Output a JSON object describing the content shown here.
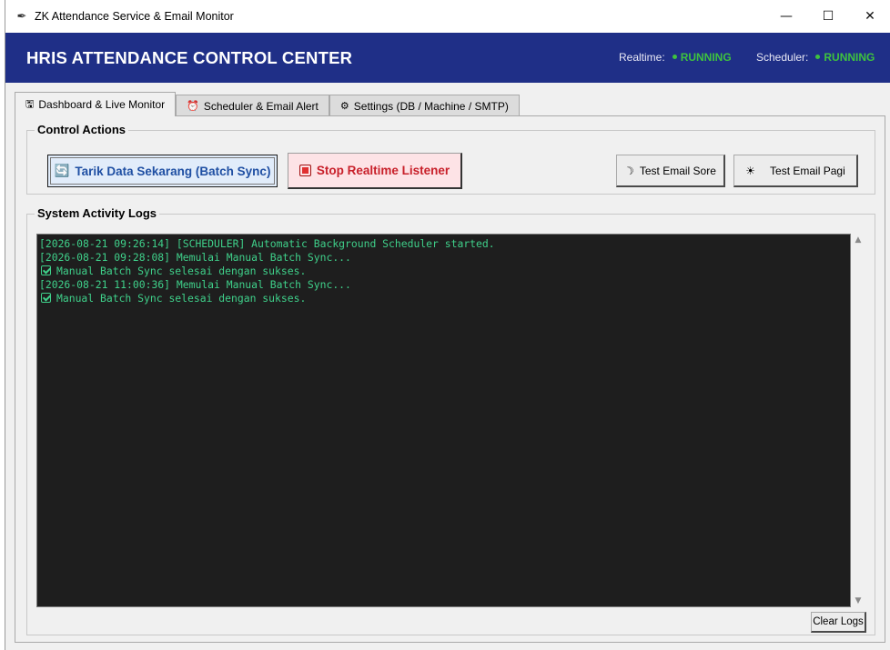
{
  "window": {
    "title": "ZK Attendance Service & Email Monitor",
    "minimize": "—",
    "maximize": "☐",
    "close": "✕"
  },
  "header": {
    "title": "HRIS ATTENDANCE CONTROL CENTER",
    "realtime_label": "Realtime:",
    "realtime_status": "RUNNING",
    "scheduler_label": "Scheduler:",
    "scheduler_status": "RUNNING",
    "status_color": "#3ec23e",
    "bg_color": "#1f2f87"
  },
  "tabs": [
    {
      "label": "Dashboard & Live Monitor",
      "icon": "floppy-disk-icon",
      "active": true
    },
    {
      "label": "Scheduler & Email Alert",
      "icon": "alarm-clock-icon",
      "active": false
    },
    {
      "label": "Settings (DB / Machine / SMTP)",
      "icon": "gear-icon",
      "active": false
    }
  ],
  "control_actions": {
    "title": "Control Actions",
    "sync_button": "Tarik Data Sekarang (Batch Sync)",
    "stop_button": "Stop Realtime Listener",
    "test_sore_button": "Test Email Sore",
    "test_pagi_button": "Test Email Pagi"
  },
  "logs": {
    "title": "System Activity Logs",
    "lines": [
      {
        "text": "[2026-08-21 09:26:14] [SCHEDULER] Automatic Background Scheduler started.",
        "check": false
      },
      {
        "text": "[2026-08-21 09:28:08] Memulai Manual Batch Sync...",
        "check": false
      },
      {
        "text": "Manual Batch Sync selesai dengan sukses.",
        "check": true
      },
      {
        "text": "[2026-08-21 11:00:36] Memulai Manual Batch Sync...",
        "check": false
      },
      {
        "text": "Manual Batch Sync selesai dengan sukses.",
        "check": true
      }
    ],
    "text_color": "#3fd08a",
    "bg_color": "#1e1e1e",
    "clear_button": "Clear Logs"
  }
}
